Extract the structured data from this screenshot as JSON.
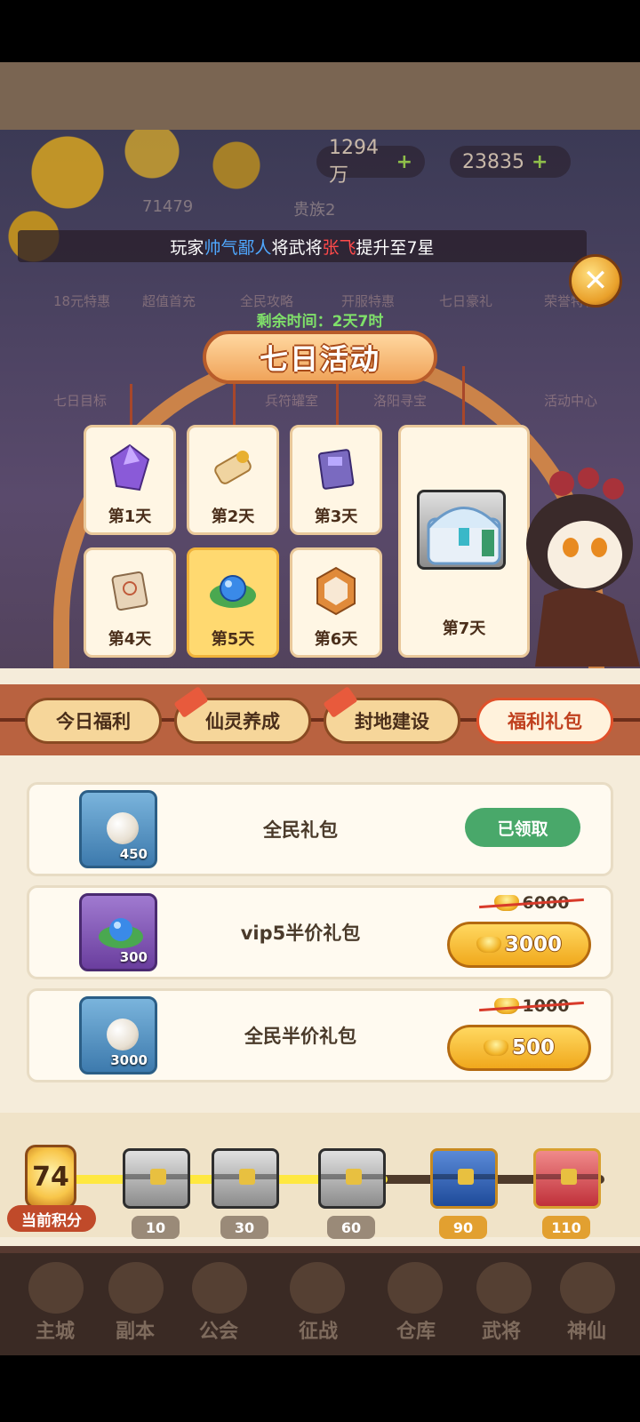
{
  "resources": {
    "silver": "1294万",
    "gold": "23835"
  },
  "player": {
    "id": "71479",
    "clan": "贵族2"
  },
  "broadcast": {
    "prefix": "玩家",
    "player_name": "帅气鄙人",
    "mid": "将武将",
    "hero_name": "张飞",
    "suffix": "提升至7星"
  },
  "background_menu": [
    "18元特惠",
    "超值首充",
    "全民攻略",
    "开服特惠",
    "七日豪礼",
    "荣誉特权",
    "七日目标",
    "兵符罐室",
    "洛阳寻宝",
    "活动中心"
  ],
  "event": {
    "timer_label": "剩余时间：2天7时",
    "title": "七日活动",
    "days": [
      "第1天",
      "第2天",
      "第3天",
      "第4天",
      "第5天",
      "第6天",
      "第7天"
    ],
    "selected_day": "第5天"
  },
  "tabs": [
    {
      "label": "今日福利"
    },
    {
      "label": "仙灵养成"
    },
    {
      "label": "封地建设"
    },
    {
      "label": "福利礼包"
    }
  ],
  "packs": [
    {
      "name": "全民礼包",
      "item_qty": "450",
      "status": "已领取"
    },
    {
      "name": "vip5半价礼包",
      "item_qty": "300",
      "old_price": "6000",
      "price": "3000"
    },
    {
      "name": "全民半价礼包",
      "item_qty": "3000",
      "old_price": "1000",
      "price": "500"
    }
  ],
  "progress": {
    "current_score": "74",
    "score_label": "当前积分",
    "milestones": [
      "10",
      "30",
      "60",
      "90",
      "110"
    ],
    "fill_fraction": 0.6
  },
  "nav": [
    "主城",
    "副本",
    "公会",
    "征战",
    "仓库",
    "武将",
    "神仙"
  ],
  "colors": {
    "accent": "#e0502a",
    "claimed": "#49a86a",
    "gold": "#f0a81c",
    "blue_name": "#4fa8ff",
    "red_name": "#ff4a4a"
  }
}
